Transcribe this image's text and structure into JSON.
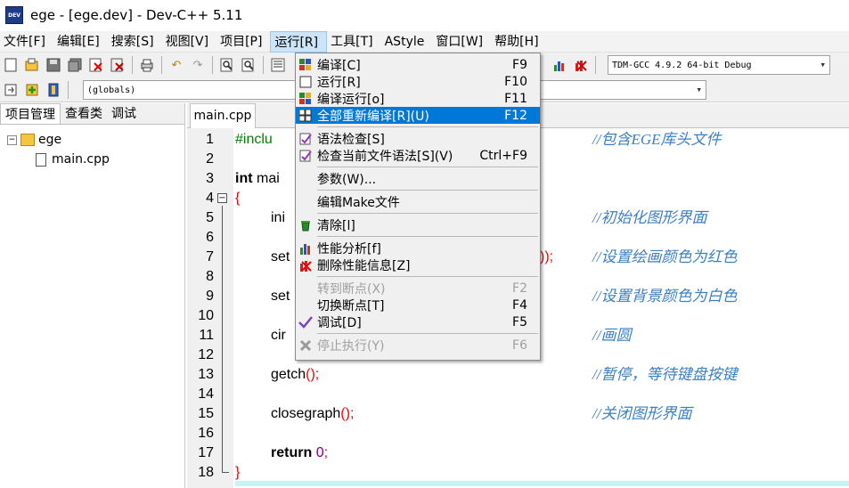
{
  "window": {
    "title": "ege - [ege.dev] - Dev-C++ 5.11",
    "icon_text": "DEV"
  },
  "menubar": [
    "文件[F]",
    "编辑[E]",
    "搜索[S]",
    "视图[V]",
    "项目[P]",
    "运行[R]",
    "工具[T]",
    "AStyle",
    "窗口[W]",
    "帮助[H]"
  ],
  "toolbar": {
    "compiler": "TDM-GCC 4.9.2 64-bit Debug",
    "scope": "(globals)"
  },
  "left_panel": {
    "tabs": [
      "项目管理",
      "查看类",
      "调试"
    ],
    "project": "ege",
    "file": "main.cpp"
  },
  "editor": {
    "tab": "main.cpp",
    "line_numbers": [
      "1",
      "2",
      "3",
      "4",
      "5",
      "6",
      "7",
      "8",
      "9",
      "10",
      "11",
      "12",
      "13",
      "14",
      "15",
      "16",
      "17",
      "18"
    ],
    "fold_markers": [
      "−",
      "−"
    ],
    "lines": {
      "l1": "#inclu",
      "l3_kw": "int",
      "l3_rest": " mai",
      "l4": "{",
      "l5": "ini",
      "l7": "set",
      "l7_tail": "));",
      "l9": "set",
      "l11": "cir",
      "l13_name": "getch",
      "l13_punct": "();",
      "l15_name": "closegraph",
      "l15_punct": "();",
      "l17_kw": "return",
      "l17_num": "0",
      "l17_semi": ";",
      "l18": "}"
    },
    "comments": {
      "c1": "//包含EGE库头文件",
      "c5": "//初始化图形界面",
      "c7": "//设置绘画颜色为红色",
      "c9": "//设置背景颜色为白色",
      "c11": "//画圆",
      "c13": "//暂停，等待键盘按键",
      "c15": "//关闭图形界面"
    }
  },
  "run_menu": {
    "items": [
      {
        "label": "编译[C]",
        "key": "F9",
        "icon": "compile-icon"
      },
      {
        "label": "运行[R]",
        "key": "F10",
        "icon": "run-icon"
      },
      {
        "label": "编译运行[o]",
        "key": "F11",
        "icon": "compile-run-icon"
      },
      {
        "label": "全部重新编译[R](U)",
        "key": "F12",
        "icon": "rebuild-all-icon"
      },
      {
        "label": "语法检查[S]",
        "key": "",
        "icon": "syntax-check-icon"
      },
      {
        "label": "检查当前文件语法[S](V)",
        "key": "Ctrl+F9",
        "icon": "syntax-check-file-icon"
      },
      {
        "label": "参数(W)...",
        "key": ""
      },
      {
        "label": "编辑Make文件",
        "key": ""
      },
      {
        "label": "清除[l]",
        "key": "",
        "icon": "clean-icon"
      },
      {
        "label": "性能分析[f]",
        "key": "",
        "icon": "profile-icon"
      },
      {
        "label": "删除性能信息[Z]",
        "key": "",
        "icon": "delete-profile-icon"
      },
      {
        "label": "转到断点(X)",
        "key": "F2"
      },
      {
        "label": "切换断点[T]",
        "key": "F4"
      },
      {
        "label": "调试[D]",
        "key": "F5",
        "icon": "debug-check-icon"
      },
      {
        "label": "停止执行(Y)",
        "key": "F6",
        "icon": "stop-icon"
      }
    ]
  },
  "colors": {
    "highlight": "#0078d7",
    "comment": "#3b7fc4",
    "string_red": "#ff0000",
    "number": "#800080"
  }
}
